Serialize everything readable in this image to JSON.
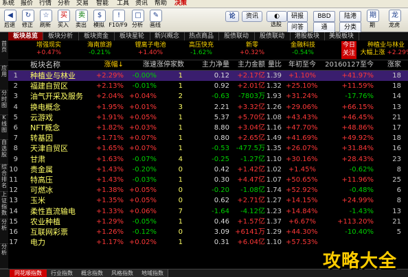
{
  "menu": [
    "系统",
    "报价",
    "行情",
    "分析",
    "交易",
    "智能",
    "工具",
    "资讯",
    "帮助",
    "决策"
  ],
  "toolbar": {
    "buttons": [
      {
        "icon": "◀",
        "label": "后退"
      },
      {
        "icon": "↻",
        "label": "修正"
      },
      {
        "icon": "☆",
        "label": "刷新"
      },
      {
        "icon": "买",
        "label": "买入"
      },
      {
        "icon": "卖",
        "label": "卖出"
      },
      {
        "icon": "$",
        "label": "模拟"
      },
      {
        "icon": "!",
        "label": "F10/F9"
      },
      {
        "icon": "□",
        "label": "分析"
      },
      {
        "icon": "✎",
        "label": "画线"
      }
    ],
    "lun_label": "论",
    "zixun_label": "资讯",
    "xuangu_label": "选股",
    "yanbao_label": "研报",
    "bbd_label": "BBD",
    "lujiang_label": "陆港",
    "wenda_label": "问答",
    "tongyou_label": "通",
    "fenlei_label": "分类",
    "more1": "期",
    "more2": "龙虎"
  },
  "tabs": [
    "板块总览",
    "板块分析",
    "板块资金",
    "板块星轮",
    "新兴概念",
    "热点商品",
    "股债联动",
    "股债联动",
    "港股板块",
    "美股板块"
  ],
  "ticker_left": [
    "新兴",
    "概念"
  ],
  "tickers": [
    {
      "name": "增强现实",
      "value": "+0.47%",
      "dir": "up"
    },
    {
      "name": "海南旅游",
      "value": "-0.21%",
      "dir": "dn"
    },
    {
      "name": "锂离子电池",
      "value": "+1.40%",
      "dir": "up"
    },
    {
      "name": "高压快充",
      "value": "-1.62%",
      "dir": "dn"
    },
    {
      "name": "新零",
      "value": "+0.32%",
      "dir": "up"
    },
    {
      "name": "金融科技",
      "value": "-0.54%",
      "dir": "dn"
    }
  ],
  "today_focus": [
    "今日",
    "关注"
  ],
  "today_stock": {
    "name": "种植业与林业",
    "name2": "大幅上涨",
    "value": "+2.29%"
  },
  "sidebar": [
    "首页",
    "应用",
    "分时图",
    "K线图",
    "自选股",
    "综合排名",
    "上证指数",
    "分析",
    "分析"
  ],
  "table": {
    "headers": [
      "",
      "板块名称",
      "涨幅↓",
      "涨速",
      "涨停家数",
      "主力净量",
      "主力金额",
      "量比",
      "年初至今",
      "20160127至今",
      "涨家"
    ],
    "rows": [
      {
        "idx": "1",
        "name": "种植业与林业",
        "chg": "+2.29%",
        "spd": "-0.00%",
        "ztjs": "1",
        "zljl": "0.12",
        "zlje": "+2.17亿",
        "lb": "1.39",
        "ncz": "+1.10%",
        "since": "+41.97%",
        "zj": "18",
        "sel": true
      },
      {
        "idx": "2",
        "name": "福建自贸区",
        "chg": "+2.13%",
        "spd": "-0.01%",
        "ztjs": "1",
        "zljl": "0.92",
        "zlje": "+2.01亿",
        "lb": "1.32",
        "ncz": "+25.10%",
        "since": "+11.59%",
        "zj": "18"
      },
      {
        "idx": "3",
        "name": "油气开采及服务",
        "chg": "+2.04%",
        "spd": "+0.04%",
        "ztjs": "2",
        "zljl": "-0.63",
        "zlje": "-7803万",
        "lb": "1.93",
        "ncz": "+31.24%",
        "since": "-17.76%",
        "zj": "14"
      },
      {
        "idx": "4",
        "name": "换电概念",
        "chg": "+1.95%",
        "spd": "+0.01%",
        "ztjs": "3",
        "zljl": "2.21",
        "zlje": "+3.32亿",
        "lb": "1.26",
        "ncz": "+29.06%",
        "since": "+66.15%",
        "zj": "13"
      },
      {
        "idx": "5",
        "name": "云游戏",
        "chg": "+1.91%",
        "spd": "+0.05%",
        "ztjs": "1",
        "zljl": "5.37",
        "zlje": "+5.70亿",
        "lb": "1.08",
        "ncz": "+43.43%",
        "since": "+46.45%",
        "zj": "21"
      },
      {
        "idx": "6",
        "name": "NFT概念",
        "chg": "+1.82%",
        "spd": "+0.03%",
        "ztjs": "1",
        "zljl": "8.80",
        "zlje": "+3.04亿",
        "lb": "1.16",
        "ncz": "+47.70%",
        "since": "+48.86%",
        "zj": "17"
      },
      {
        "idx": "7",
        "name": "转基因",
        "chg": "+1.71%",
        "spd": "+0.07%",
        "ztjs": "1",
        "zljl": "0.80",
        "zlje": "+2.65亿",
        "lb": "1.49",
        "ncz": "+41.69%",
        "since": "+49.92%",
        "zj": "18"
      },
      {
        "idx": "8",
        "name": "天津自贸区",
        "chg": "+1.65%",
        "spd": "+0.07%",
        "ztjs": "1",
        "zljl": "-0.53",
        "zlje": "-477.5万",
        "lb": "1.35",
        "ncz": "+26.07%",
        "since": "+31.84%",
        "zj": "16"
      },
      {
        "idx": "9",
        "name": "甘肃",
        "chg": "+1.63%",
        "spd": "-0.07%",
        "ztjs": "4",
        "zljl": "-0.25",
        "zlje": "-1.27亿",
        "lb": "1.10",
        "ncz": "+30.16%",
        "since": "+28.43%",
        "zj": "23"
      },
      {
        "idx": "10",
        "name": "贵金属",
        "chg": "+1.43%",
        "spd": "-0.20%",
        "ztjs": "0",
        "zljl": "0.42",
        "zlje": "+1.42亿",
        "lb": "1.02",
        "ncz": "+1.45%",
        "since": "-0.62%",
        "zj": "8"
      },
      {
        "idx": "11",
        "name": "特高压",
        "chg": "+1.43%",
        "spd": "-0.03%",
        "ztjs": "1",
        "zljl": "0.30",
        "zlje": "+4.47亿",
        "lb": "1.07",
        "ncz": "+50.65%",
        "since": "+11.96%",
        "zj": "25"
      },
      {
        "idx": "12",
        "name": "可燃冰",
        "chg": "+1.38%",
        "spd": "+0.05%",
        "ztjs": "0",
        "zljl": "-0.20",
        "zlje": "-1.08亿",
        "lb": "1.74",
        "ncz": "+52.92%",
        "since": "-0.48%",
        "zj": "6"
      },
      {
        "idx": "13",
        "name": "玉米",
        "chg": "+1.35%",
        "spd": "+0.05%",
        "ztjs": "0",
        "zljl": "0.62",
        "zlje": "+2.71亿",
        "lb": "1.27",
        "ncz": "+14.15%",
        "since": "+24.99%",
        "zj": "8"
      },
      {
        "idx": "14",
        "name": "柔性直流输电",
        "chg": "+1.33%",
        "spd": "+0.06%",
        "ztjs": "7",
        "zljl": "-1.64",
        "zlje": "-4.12亿",
        "lb": "1.23",
        "ncz": "+14.84%",
        "since": "-1.43%",
        "zj": "13"
      },
      {
        "idx": "15",
        "name": "农业种植",
        "chg": "+1.29%",
        "spd": "-0.05%",
        "ztjs": "1",
        "zljl": "0.46",
        "zlje": "+1.57亿",
        "lb": "1.37",
        "ncz": "+6.67%",
        "since": "+113.20%",
        "zj": "21"
      },
      {
        "idx": "16",
        "name": "互联网彩票",
        "chg": "+1.26%",
        "spd": "-0.12%",
        "ztjs": "0",
        "zljl": "3.09",
        "zlje": "+6141万",
        "lb": "1.29",
        "ncz": "+44.30%",
        "since": "-10.40%",
        "zj": "5"
      },
      {
        "idx": "17",
        "name": "电力",
        "chg": "+1.17%",
        "spd": "+0.02%",
        "ztjs": "1",
        "zljl": "0.31",
        "zlje": "+6.04亿",
        "lb": "1.10",
        "ncz": "+57.53%",
        "since": "",
        "zj": ""
      }
    ]
  },
  "bottom_tabs": [
    "同花顺指数",
    "行业指数",
    "概念指数",
    "风格指数",
    "地域指数"
  ],
  "watermark": "攻略大全",
  "colors": {
    "up": "#ff3838",
    "down": "#00d000",
    "accent": "#8b0000",
    "select": "#3a1e6e"
  }
}
